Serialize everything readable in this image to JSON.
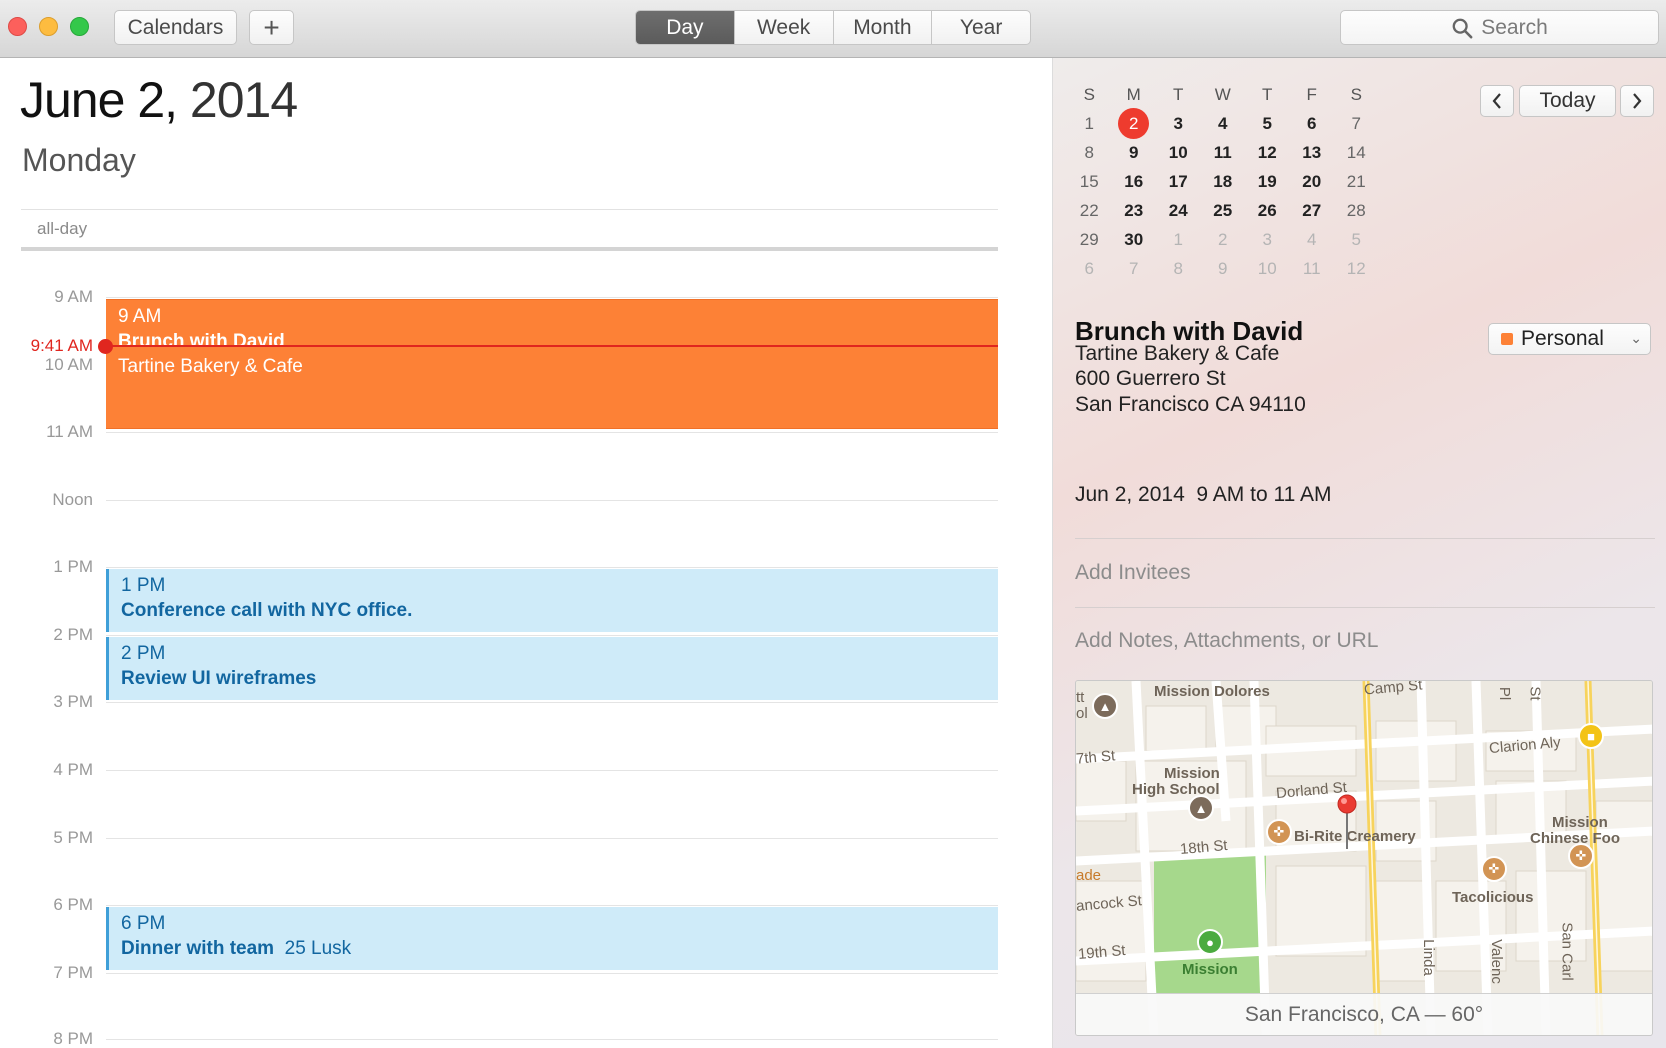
{
  "toolbar": {
    "calendars_label": "Calendars",
    "add_label": "+",
    "views": [
      "Day",
      "Week",
      "Month",
      "Year"
    ],
    "active_view": "Day",
    "search_placeholder": "Search"
  },
  "day": {
    "date_main": "June 2,",
    "date_year": "2014",
    "weekday": "Monday",
    "allday_label": "all-day",
    "hours": [
      "9 AM",
      "10 AM",
      "11 AM",
      "Noon",
      "1 PM",
      "2 PM",
      "3 PM",
      "4 PM",
      "5 PM",
      "6 PM",
      "7 PM",
      "8 PM"
    ],
    "now_label": "9:41 AM",
    "events": [
      {
        "time": "9 AM",
        "title": "Brunch with David",
        "detail": "Tartine Bakery & Cafe",
        "color": "#fd8136"
      },
      {
        "time": "1 PM",
        "title": "Conference call with NYC office.",
        "detail": "",
        "color": "#cfebf9"
      },
      {
        "time": "2 PM",
        "title": "Review UI wireframes",
        "detail": "",
        "color": "#cfebf9"
      },
      {
        "time": "6 PM",
        "title": "Dinner with team",
        "detail": "25 Lusk",
        "color": "#cfebf9"
      }
    ]
  },
  "mini_calendar": {
    "weekdays": [
      "S",
      "M",
      "T",
      "W",
      "T",
      "F",
      "S"
    ],
    "weeks": [
      [
        "1",
        "2",
        "3",
        "4",
        "5",
        "6",
        "7"
      ],
      [
        "8",
        "9",
        "10",
        "11",
        "12",
        "13",
        "14"
      ],
      [
        "15",
        "16",
        "17",
        "18",
        "19",
        "20",
        "21"
      ],
      [
        "22",
        "23",
        "24",
        "25",
        "26",
        "27",
        "28"
      ],
      [
        "29",
        "30",
        "1",
        "2",
        "3",
        "4",
        "5"
      ],
      [
        "6",
        "7",
        "8",
        "9",
        "10",
        "11",
        "12"
      ]
    ],
    "selected_day": "2",
    "today_label": "Today",
    "prev_label": "<",
    "next_label": ">"
  },
  "inspector": {
    "title": "Brunch with David",
    "calendar": "Personal",
    "calendar_color": "#fd8136",
    "address_lines": [
      "Tartine Bakery & Cafe",
      "600 Guerrero St",
      "San Francisco CA 94110"
    ],
    "when": "Jun 2, 2014  9 AM to 11 AM",
    "invitees_placeholder": "Add Invitees",
    "notes_placeholder": "Add Notes, Attachments, or URL"
  },
  "map": {
    "labels": [
      "Mission Dolores",
      "Camp St",
      "Clarion Aly",
      "7th St",
      "Mission",
      "High School",
      "Dorland St",
      "Bi-Rite Creamery",
      "18th St",
      "Mission",
      "Chinese Foo",
      "Tacolicious",
      "ade",
      "ancock St",
      "19th St",
      "Mission",
      "Linda",
      "Valenc",
      "San Carl",
      "tt",
      "ol",
      "Pl",
      "St"
    ],
    "caption": "San Francisco, CA — 60°"
  }
}
